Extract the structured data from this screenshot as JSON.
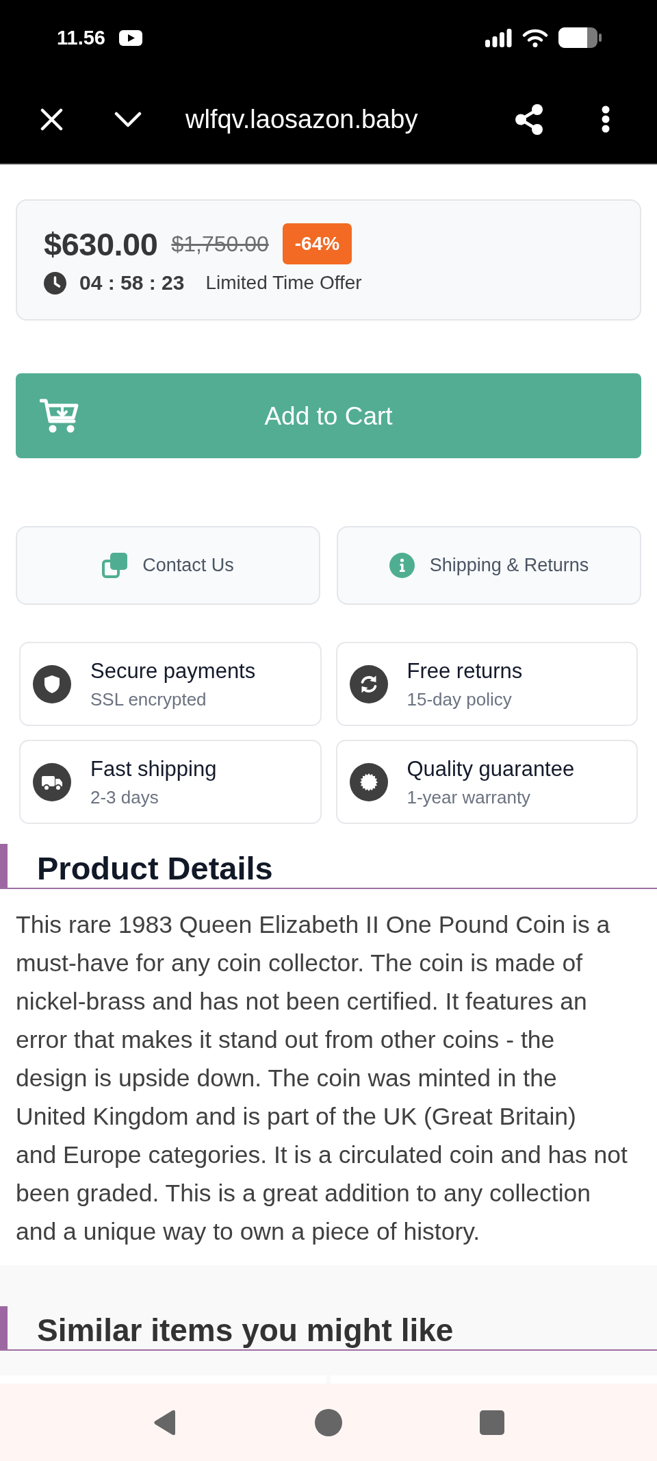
{
  "status_bar": {
    "time": "11.56"
  },
  "browser_bar": {
    "url": "wlfqv.laosazon.baby"
  },
  "price_card": {
    "price": "$630.00",
    "original_price": "$1,750.00",
    "discount": "-64%",
    "countdown": "04 : 58 : 23",
    "offer_label": "Limited Time Offer"
  },
  "add_to_cart": {
    "label": "Add to Cart"
  },
  "action_buttons": [
    {
      "kind": "contact",
      "label": "Contact Us"
    },
    {
      "kind": "info",
      "label": "Shipping & Returns"
    }
  ],
  "features": [
    {
      "kind": "shield",
      "title": "Secure payments",
      "subtitle": "SSL encrypted"
    },
    {
      "kind": "refresh",
      "title": "Free returns",
      "subtitle": "15-day policy"
    },
    {
      "kind": "truck",
      "title": "Fast shipping",
      "subtitle": "2-3 days"
    },
    {
      "kind": "seal",
      "title": "Quality guarantee",
      "subtitle": "1-year warranty"
    }
  ],
  "product_details": {
    "heading": "Product Details",
    "text_lines": [
      "This rare 1983 Queen Elizabeth II One Pound Coin is a",
      "must-have for any coin collector. The coin is made of",
      "nickel-brass and has not been certified. It features an",
      "error that makes it stand out from other coins - the",
      "design is upside down. The coin was minted in the",
      "United Kingdom and is part of the UK (Great Britain)",
      "and Europe categories. It is a circulated coin and has not",
      "been graded. This is a great addition to any collection",
      "and a unique way to own a piece of history."
    ]
  },
  "similar_items": {
    "heading": "Similar items you might like"
  }
}
